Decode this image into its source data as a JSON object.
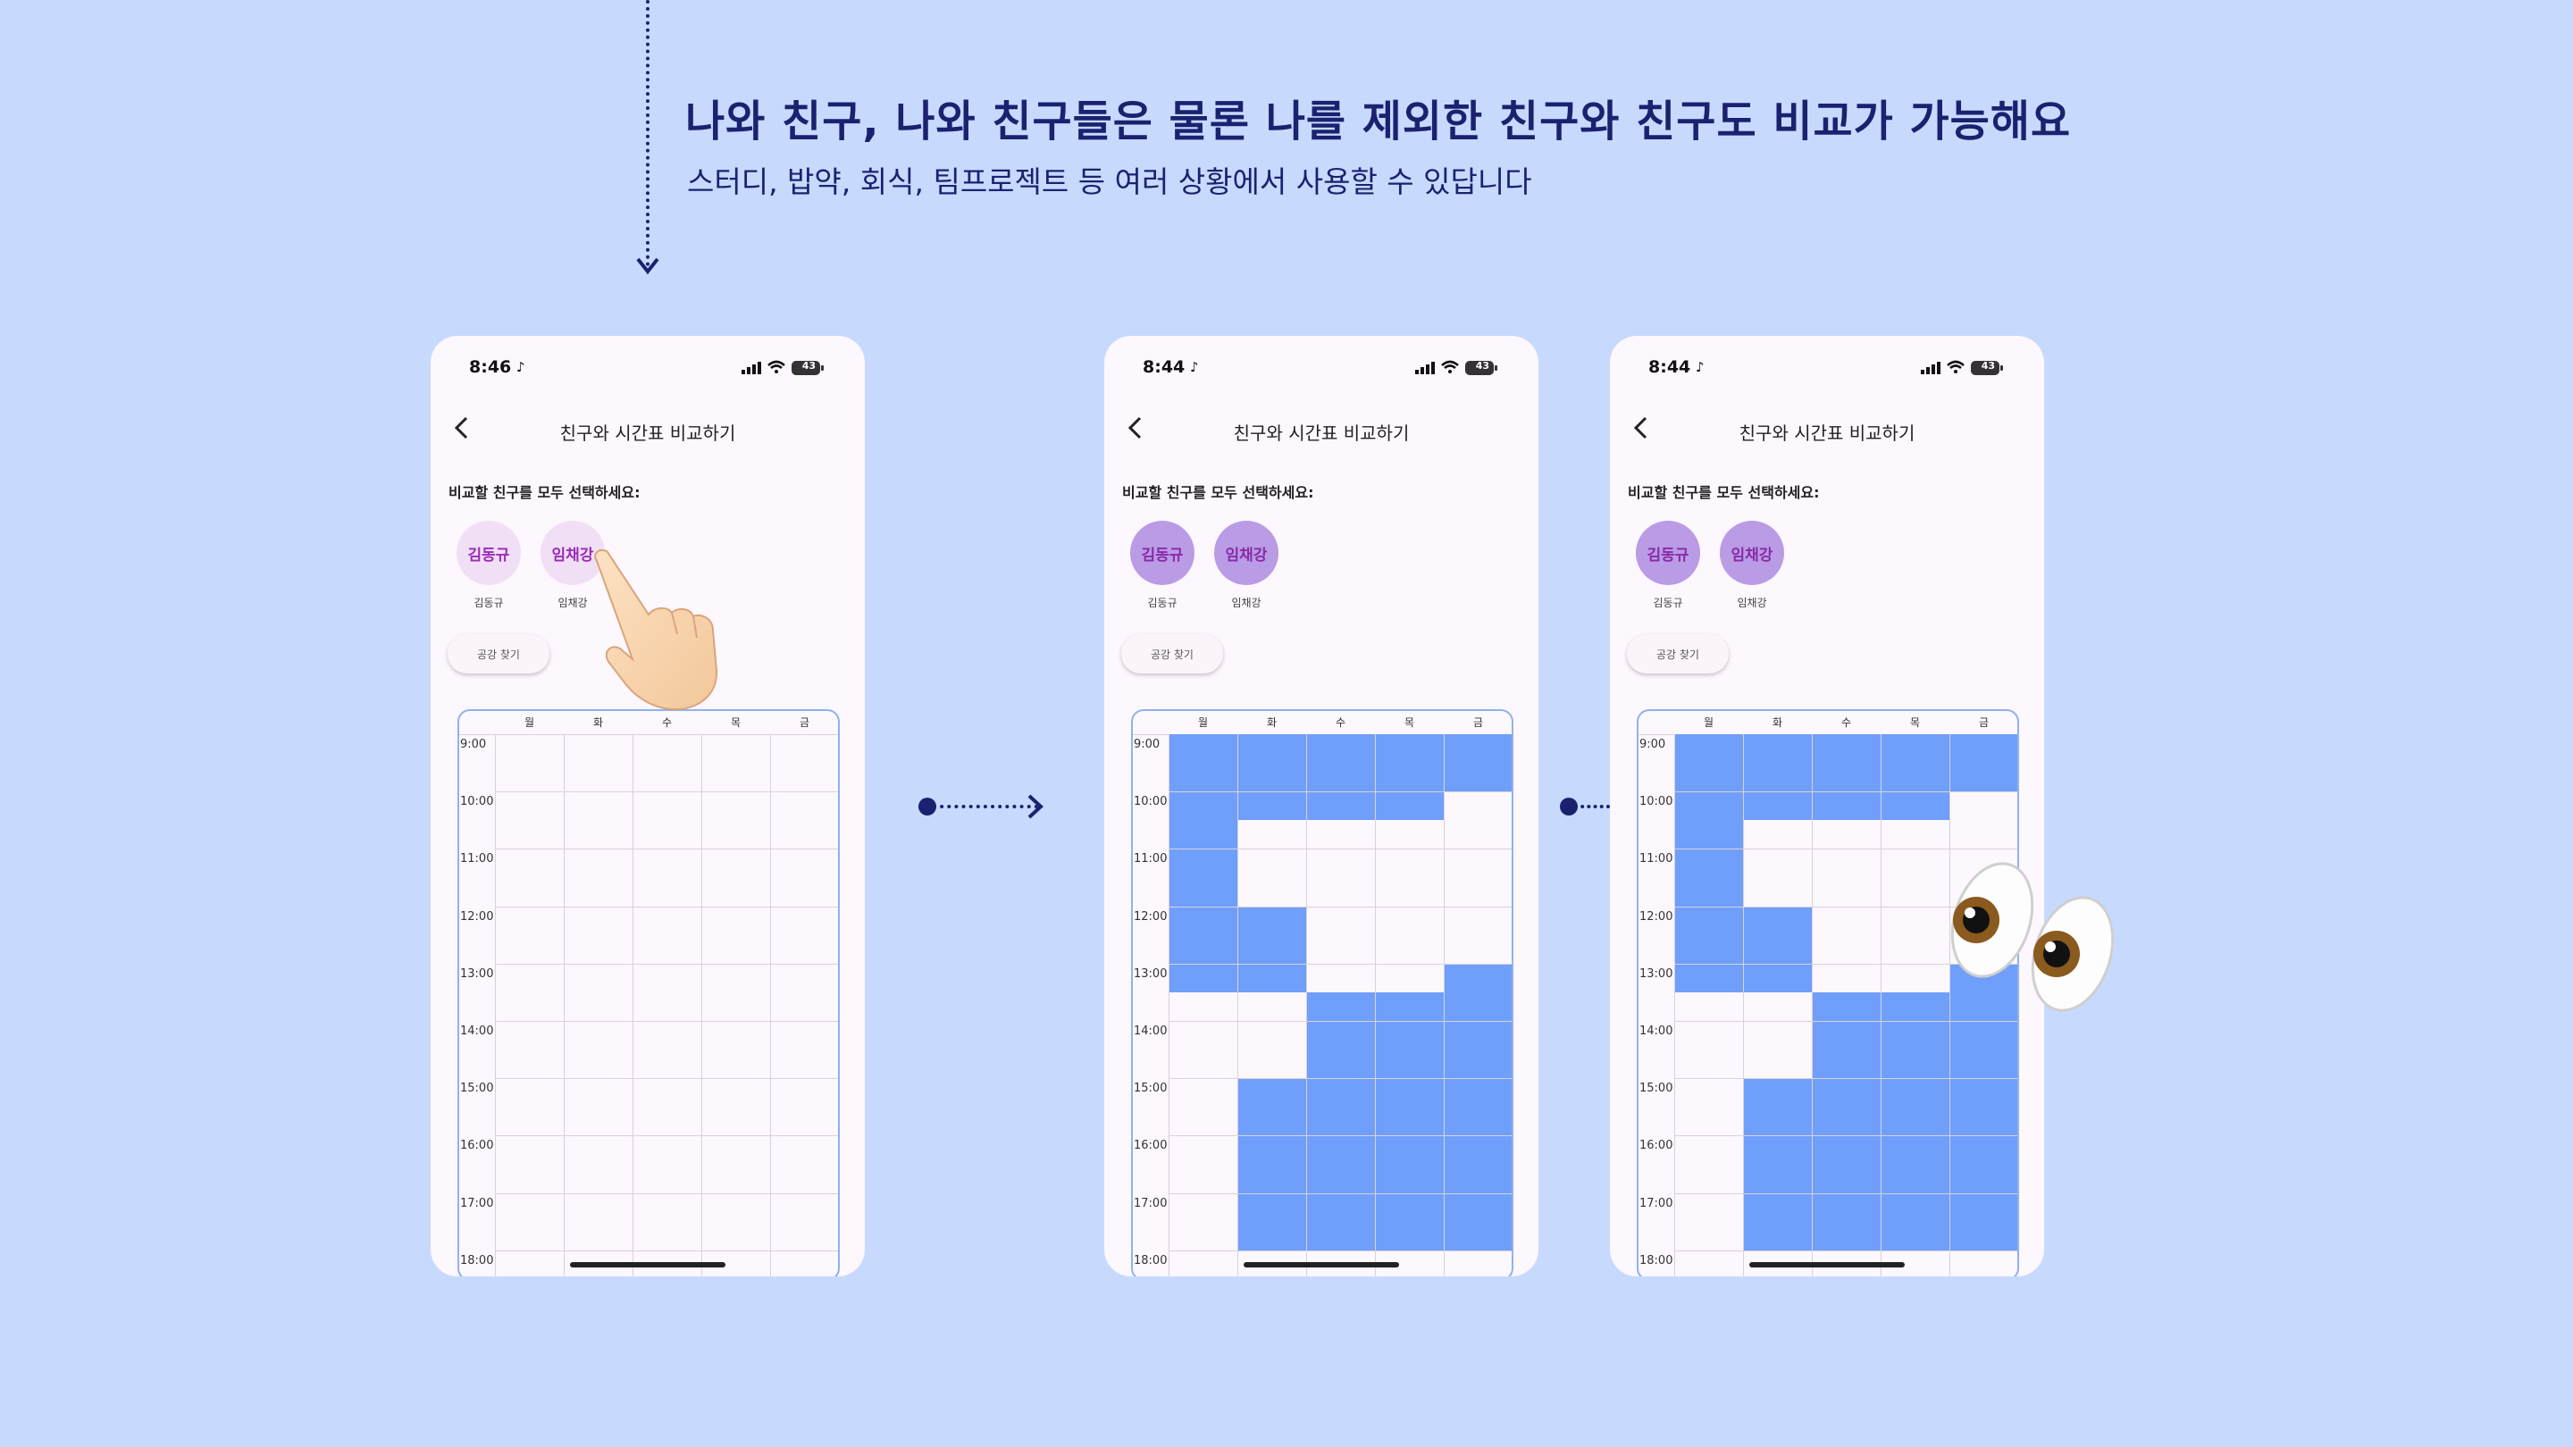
{
  "headline": "나와 친구, 나와 친구들은 물론 나를 제외한 친구와 친구도 비교가 가능해요",
  "subline": "스터디, 밥약, 회식, 팀프로젝트 등 여러 상황에서 사용할 수 있답니다",
  "phones": [
    {
      "time": "8:46",
      "battery": "43",
      "title": "친구와 시간표 비교하기",
      "prompt": "비교할 친구를 모두 선택하세요:",
      "friends": [
        {
          "chip": "김동규",
          "name": "김동규",
          "selected": false
        },
        {
          "chip": "임채강",
          "name": "임채강",
          "selected": false
        }
      ],
      "find_button": "공강 찾기"
    },
    {
      "time": "8:44",
      "battery": "43",
      "title": "친구와 시간표 비교하기",
      "prompt": "비교할 친구를 모두 선택하세요:",
      "friends": [
        {
          "chip": "김동규",
          "name": "김동규",
          "selected": true
        },
        {
          "chip": "임채강",
          "name": "임채강",
          "selected": true
        }
      ],
      "find_button": "공강 찾기"
    },
    {
      "time": "8:44",
      "battery": "43",
      "title": "친구와 시간표 비교하기",
      "prompt": "비교할 친구를 모두 선택하세요:",
      "friends": [
        {
          "chip": "김동규",
          "name": "김동규",
          "selected": true
        },
        {
          "chip": "임채강",
          "name": "임채강",
          "selected": true
        }
      ],
      "find_button": "공강 찾기"
    }
  ],
  "days": [
    "월",
    "화",
    "수",
    "목",
    "금"
  ],
  "times": [
    "9:00",
    "10:00",
    "11:00",
    "12:00",
    "13:00",
    "14:00",
    "15:00",
    "16:00",
    "17:00",
    "18:00"
  ],
  "busy_blocks": [
    {
      "day": 0,
      "start": 9.0,
      "end": 13.5
    },
    {
      "day": 1,
      "start": 9.0,
      "end": 10.5
    },
    {
      "day": 1,
      "start": 12.0,
      "end": 13.5
    },
    {
      "day": 1,
      "start": 15.0,
      "end": 18.0
    },
    {
      "day": 2,
      "start": 9.0,
      "end": 10.5
    },
    {
      "day": 2,
      "start": 13.5,
      "end": 18.0
    },
    {
      "day": 3,
      "start": 9.0,
      "end": 10.5
    },
    {
      "day": 3,
      "start": 13.5,
      "end": 18.0
    },
    {
      "day": 4,
      "start": 9.0,
      "end": 10.0
    },
    {
      "day": 4,
      "start": 13.0,
      "end": 18.0
    }
  ],
  "icons": [
    "back-chevron-icon",
    "silent-bell-icon",
    "signal-icon",
    "wifi-icon",
    "battery-icon",
    "pointing-hand-icon",
    "eyes-icon"
  ]
}
